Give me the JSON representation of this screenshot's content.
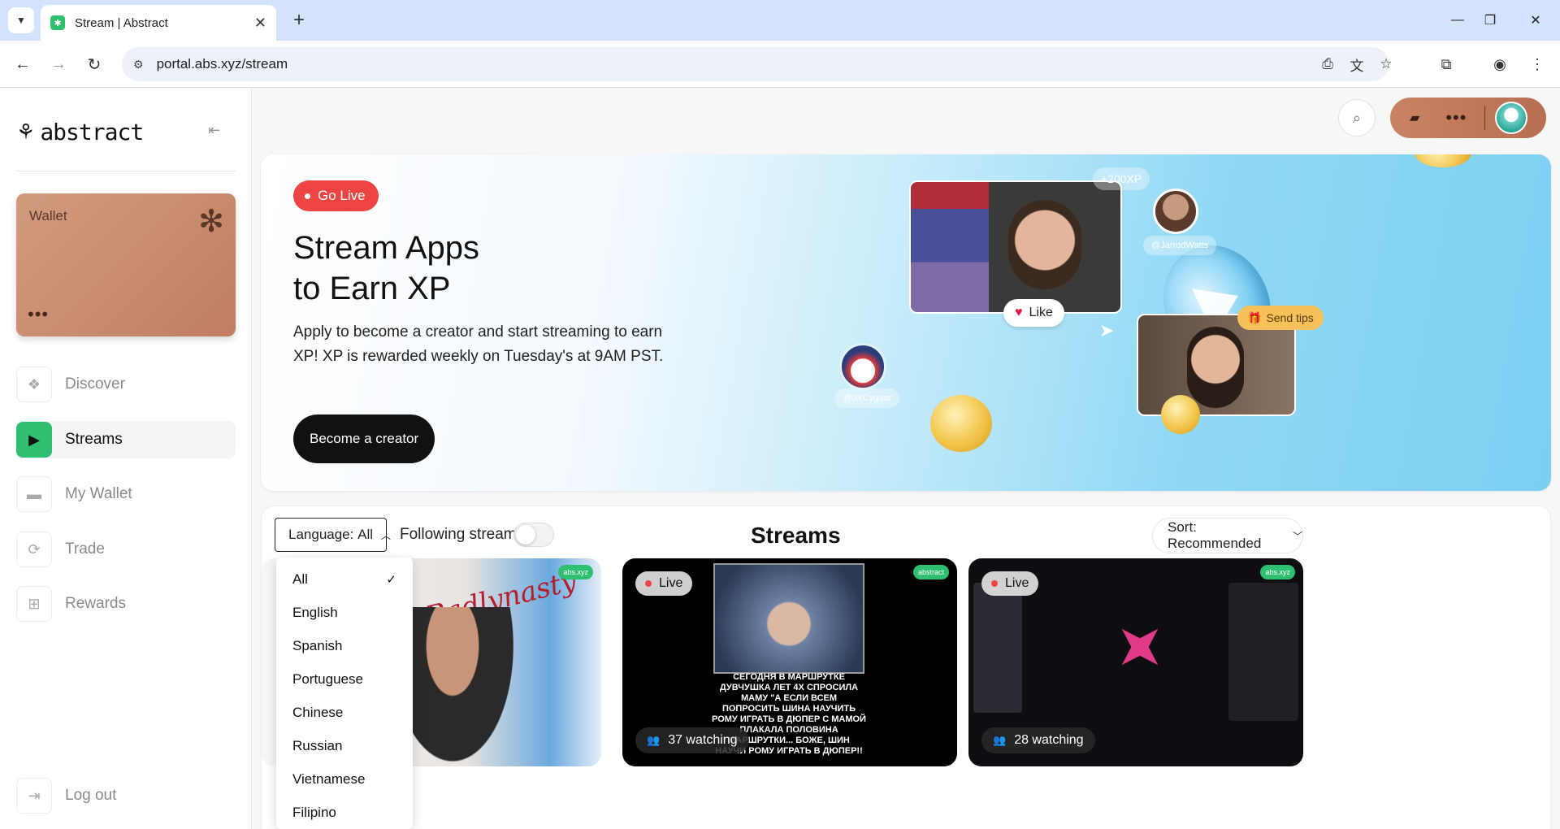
{
  "browser": {
    "tab_title": "Stream | Abstract",
    "url": "portal.abs.xyz/stream"
  },
  "sidebar": {
    "logo_text": "abstract",
    "wallet_label": "Wallet",
    "wallet_dots": "•••",
    "items": [
      {
        "label": "Discover",
        "icon": "discover-icon",
        "active": false
      },
      {
        "label": "Streams",
        "icon": "play-icon",
        "active": true
      },
      {
        "label": "My Wallet",
        "icon": "wallet-icon",
        "active": false
      },
      {
        "label": "Trade",
        "icon": "trade-icon",
        "active": false
      },
      {
        "label": "Rewards",
        "icon": "gift-icon",
        "active": false
      }
    ],
    "logout_label": "Log out"
  },
  "header": {
    "account_dots": "•••"
  },
  "hero": {
    "go_live": "Go Live",
    "title_line1": "Stream Apps",
    "title_line2": "to Earn XP",
    "description": "Apply to become a creator and start streaming to earn XP! XP is rewarded weekly on Tuesday's at 9AM PST.",
    "cta": "Become a creator",
    "xp_badge": "+200XP",
    "like_label": "Like",
    "send_tips_label": "Send tips",
    "handle_1": "@JarrodWatts",
    "handle_2": "@0XCygaar"
  },
  "streams": {
    "language_label": "Language:",
    "language_value": "All",
    "following_label": "Following streams",
    "title": "Streams",
    "sort_label": "Sort: Recommended",
    "live_label": "Live",
    "cards": [
      {
        "watching": "",
        "sign": "Badlynasty",
        "chip": "abs.xyz"
      },
      {
        "watching": "37 watching",
        "caption": "СЕГОДНЯ В МАРШРУТКЕ ДУВЧУШКА ЛЕТ 4Х СПРОСИЛА МАМУ \"А ЕСЛИ ВСЕМ ПОПРОСИТЬ ШИНА НАУЧИТЬ РОМУ ИГРАТЬ В ДЮПЕР С МАМОЙ ПЛАКАЛА ПОЛОВИНА МАРШРУТКИ... БОЖЕ, ШИН НАУЧИ РОМУ ИГРАТЬ В ДЮПЕР!!",
        "chip": "abstract"
      },
      {
        "watching": "28 watching",
        "chip": "abs.xyz"
      }
    ]
  },
  "language_menu": {
    "options": [
      "All",
      "English",
      "Spanish",
      "Portuguese",
      "Chinese",
      "Russian",
      "Vietnamese",
      "Filipino"
    ],
    "selected": "All"
  },
  "colors": {
    "accent_green": "#2fbf71",
    "live_red": "#ef4444",
    "wallet_copper": "#c98363"
  }
}
